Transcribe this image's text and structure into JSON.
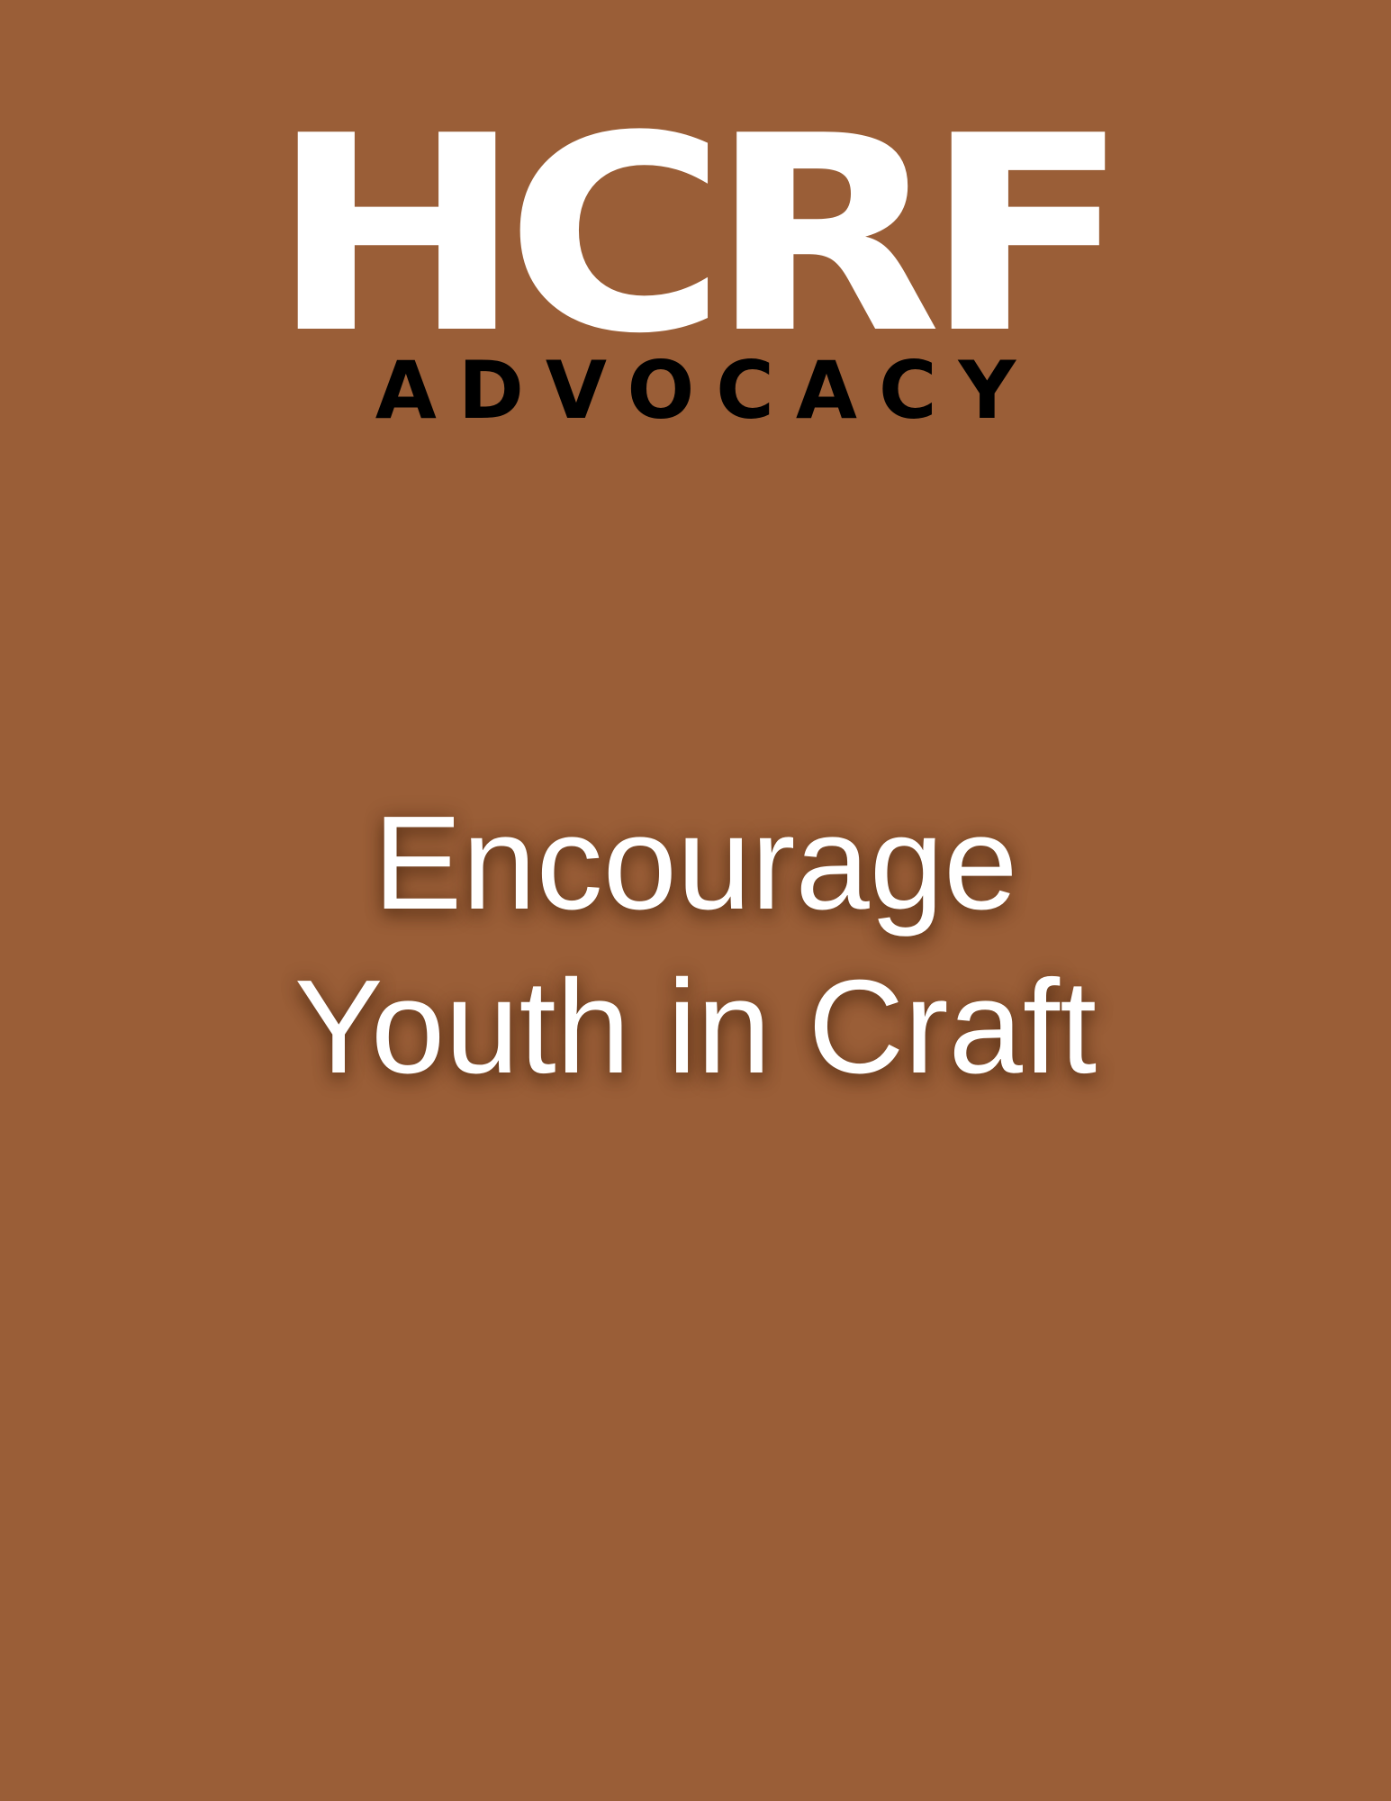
{
  "colors": {
    "background": "#9a5e37",
    "logo": "#ffffff",
    "subtitle": "#000000",
    "headline": "#ffffff"
  },
  "logo": {
    "mark": "HCRF",
    "sub": "ADVOCACY"
  },
  "headline": {
    "line1": "Encourage",
    "line2": "Youth in Craft"
  }
}
